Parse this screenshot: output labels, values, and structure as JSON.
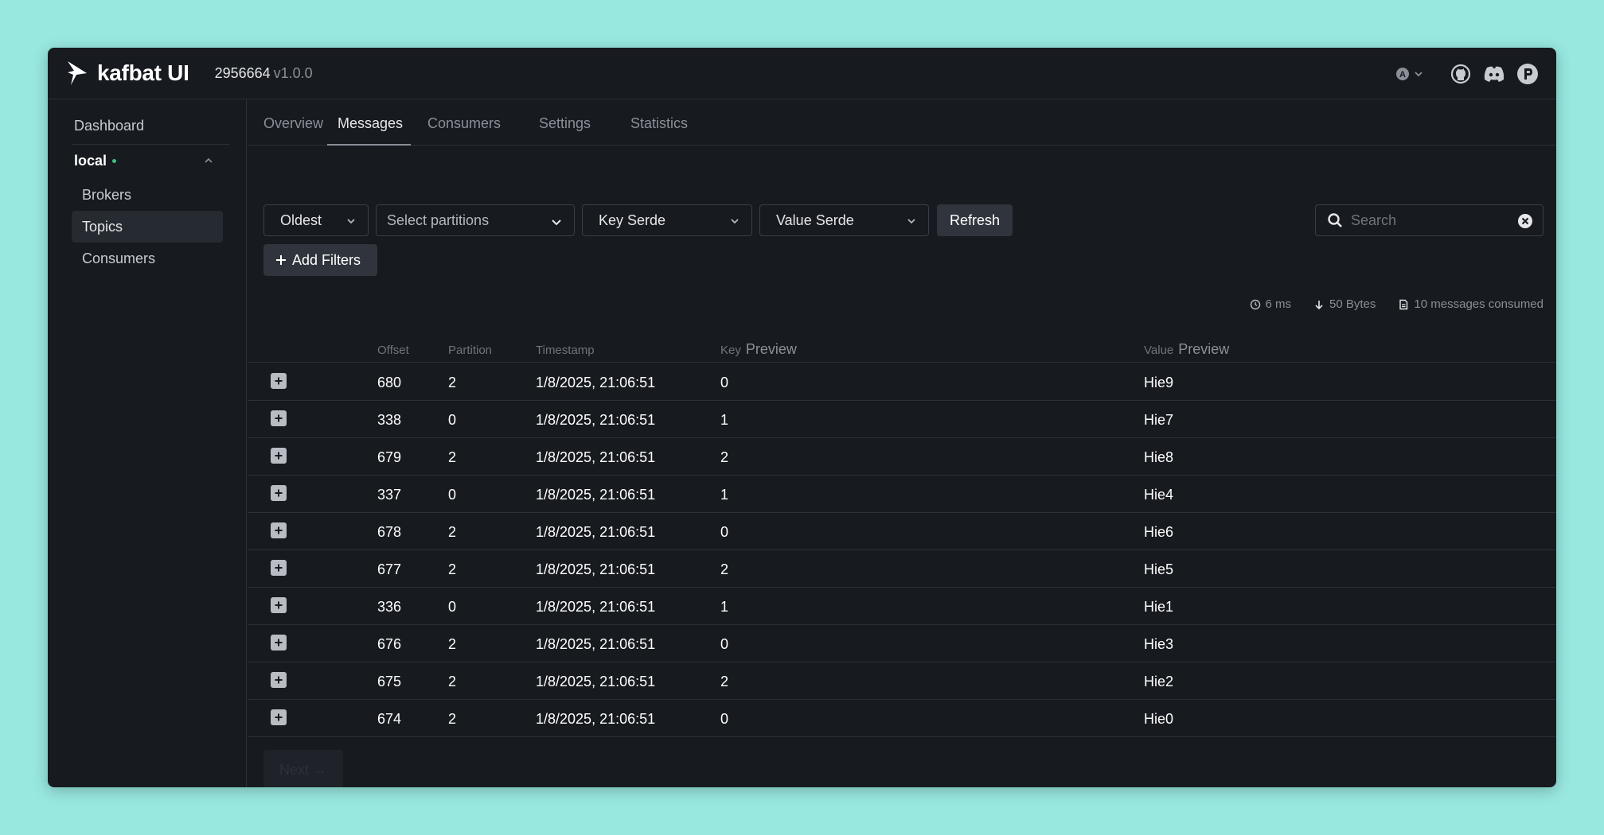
{
  "header": {
    "brand": "kafbat UI",
    "version_hash": "2956664",
    "version_tag": "v1.0.0"
  },
  "sidebar": {
    "dashboard": "Dashboard",
    "cluster": "local",
    "items": [
      {
        "label": "Brokers",
        "active": false
      },
      {
        "label": "Topics",
        "active": true
      },
      {
        "label": "Consumers",
        "active": false
      }
    ]
  },
  "tabs": [
    {
      "label": "Overview",
      "active": false
    },
    {
      "label": "Messages",
      "active": true
    },
    {
      "label": "Consumers",
      "active": false
    },
    {
      "label": "Settings",
      "active": false
    },
    {
      "label": "Statistics",
      "active": false
    }
  ],
  "filters": {
    "seek": "Oldest",
    "partitions_placeholder": "Select partitions",
    "key_serde": "Key Serde",
    "value_serde": "Value Serde",
    "refresh": "Refresh",
    "add_filters": "Add Filters",
    "search_placeholder": "Search"
  },
  "stats": {
    "elapsed": "6 ms",
    "bytes": "50 Bytes",
    "consumed": "10 messages consumed"
  },
  "table": {
    "headers": {
      "offset": "Offset",
      "partition": "Partition",
      "timestamp": "Timestamp",
      "key": "Key",
      "key_preview": "Preview",
      "value": "Value",
      "value_preview": "Preview"
    },
    "rows": [
      {
        "offset": "680",
        "partition": "2",
        "timestamp": "1/8/2025, 21:06:51",
        "key": "0",
        "value": "Hie9"
      },
      {
        "offset": "338",
        "partition": "0",
        "timestamp": "1/8/2025, 21:06:51",
        "key": "1",
        "value": "Hie7"
      },
      {
        "offset": "679",
        "partition": "2",
        "timestamp": "1/8/2025, 21:06:51",
        "key": "2",
        "value": "Hie8"
      },
      {
        "offset": "337",
        "partition": "0",
        "timestamp": "1/8/2025, 21:06:51",
        "key": "1",
        "value": "Hie4"
      },
      {
        "offset": "678",
        "partition": "2",
        "timestamp": "1/8/2025, 21:06:51",
        "key": "0",
        "value": "Hie6"
      },
      {
        "offset": "677",
        "partition": "2",
        "timestamp": "1/8/2025, 21:06:51",
        "key": "2",
        "value": "Hie5"
      },
      {
        "offset": "336",
        "partition": "0",
        "timestamp": "1/8/2025, 21:06:51",
        "key": "1",
        "value": "Hie1"
      },
      {
        "offset": "676",
        "partition": "2",
        "timestamp": "1/8/2025, 21:06:51",
        "key": "0",
        "value": "Hie3"
      },
      {
        "offset": "675",
        "partition": "2",
        "timestamp": "1/8/2025, 21:06:51",
        "key": "2",
        "value": "Hie2"
      },
      {
        "offset": "674",
        "partition": "2",
        "timestamp": "1/8/2025, 21:06:51",
        "key": "0",
        "value": "Hie0"
      }
    ]
  },
  "pagination": {
    "next": "Next →"
  },
  "colors": {
    "background": "#98e8e0",
    "window": "#171a1f",
    "cluster_status": "#3ac27e"
  }
}
